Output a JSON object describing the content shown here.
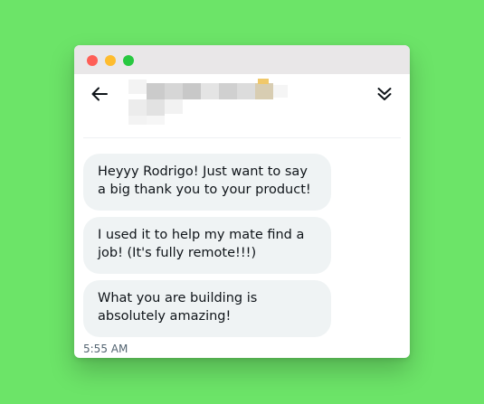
{
  "colors": {
    "background": "#6ce468",
    "titlebar": "#e9e7e8",
    "close_dot": "#fe5f57",
    "minimize_dot": "#febc2e",
    "zoom_dot": "#28c840",
    "bubble": "#eff3f4",
    "text": "#0f1419",
    "muted_text": "#536471"
  },
  "header": {
    "back_icon": "arrow-left-icon",
    "collapse_icon": "double-chevron-down-icon",
    "contact_name_blurred": true
  },
  "messages": [
    {
      "text": "Heyyy Rodrigo! Just want to say a big thank you to your product!"
    },
    {
      "text": "I used it to help my mate find a job! (It's fully remote!!!)"
    },
    {
      "text": "What you are building is absolutely amazing!"
    }
  ],
  "timestamp": "5:55 AM"
}
